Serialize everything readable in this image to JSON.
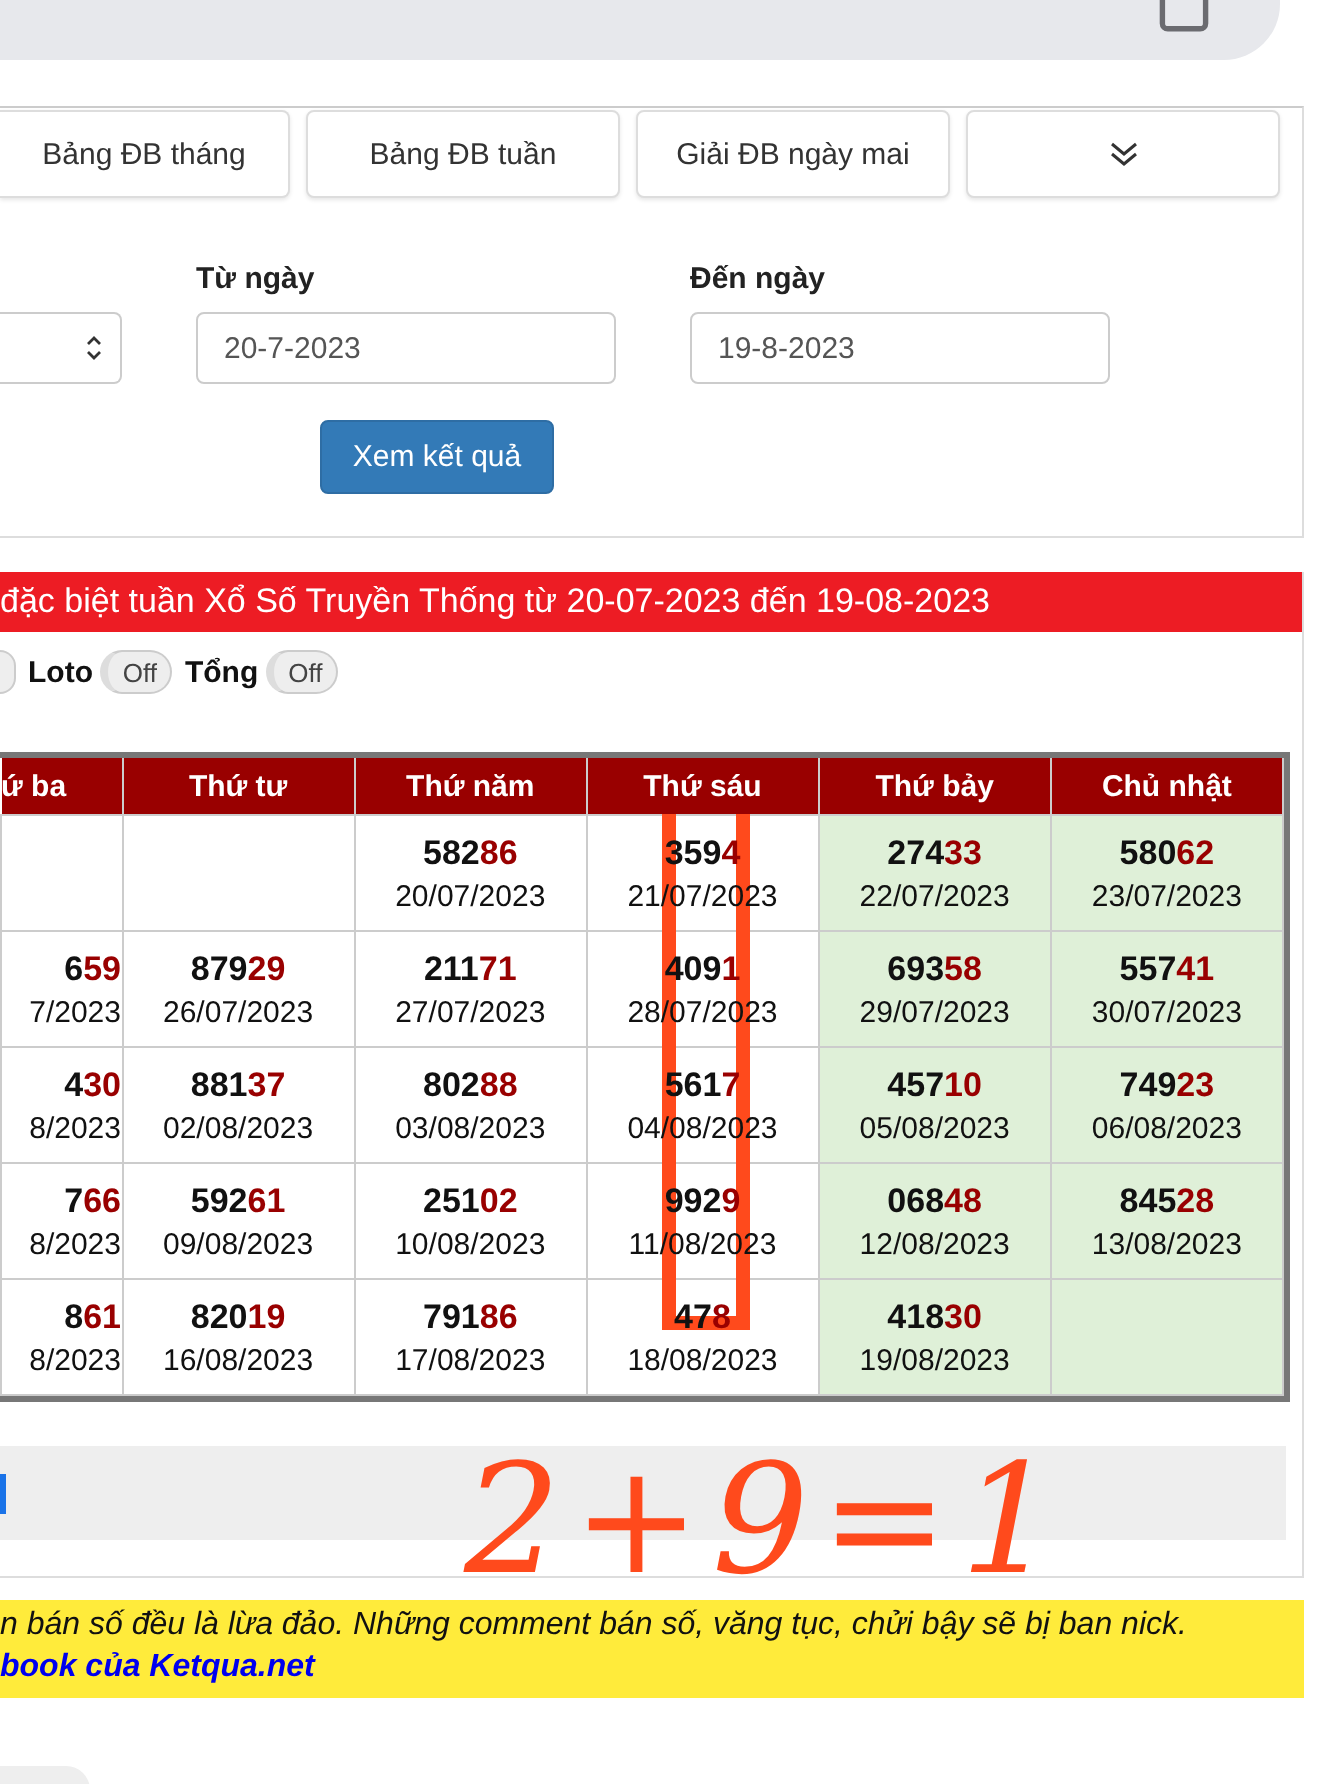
{
  "nav_buttons": [
    {
      "kind": "text",
      "label": "Bảng ĐB tháng"
    },
    {
      "kind": "text",
      "label": "Bảng ĐB tuần"
    },
    {
      "kind": "text",
      "label": "Giải ĐB ngày mai"
    },
    {
      "kind": "menu"
    }
  ],
  "filter": {
    "type_select": {
      "kind": "dropdown"
    },
    "from_label": "Từ ngày",
    "from_value": "20-7-2023",
    "to_label": "Đến ngày",
    "to_value": "19-8-2023",
    "button": "Xem kết quả"
  },
  "result_title": "đặc biệt tuần Xổ Số Truyền Thống từ 20-07-2023 đến 19-08-2023",
  "cut_toggle": {
    "on": false
  },
  "toggles": [
    {
      "label": "Loto",
      "state_text": "Off",
      "on": false
    },
    {
      "label": "Tổng",
      "state_text": "Off",
      "on": false
    }
  ],
  "table": {
    "columns": [
      {
        "label": "ứ ba",
        "weekend": false
      },
      {
        "label": "Thứ tư",
        "weekend": false
      },
      {
        "label": "Thứ năm",
        "weekend": false
      },
      {
        "label": "Thứ sáu",
        "weekend": false
      },
      {
        "label": "Thứ bảy",
        "weekend": true
      },
      {
        "label": "Chủ nhật",
        "weekend": true
      }
    ],
    "rows": [
      [
        {
          "kind": "empty"
        },
        {
          "kind": "empty"
        },
        {
          "kind": "result",
          "head": "582",
          "tail": "86",
          "date": "20/07/2023"
        },
        {
          "kind": "result",
          "head": "359",
          "tail": "4",
          "date": "21/07/2023"
        },
        {
          "kind": "result",
          "head": "274",
          "tail": "33",
          "date": "22/07/2023"
        },
        {
          "kind": "result",
          "head": "580",
          "tail": "62",
          "date": "23/07/2023"
        }
      ],
      [
        {
          "kind": "result",
          "head": "6",
          "tail": "59",
          "date": "7/2023"
        },
        {
          "kind": "result",
          "head": "879",
          "tail": "29",
          "date": "26/07/2023"
        },
        {
          "kind": "result",
          "head": "211",
          "tail": "71",
          "date": "27/07/2023"
        },
        {
          "kind": "result",
          "head": "409",
          "tail": "1",
          "date": "28/07/2023"
        },
        {
          "kind": "result",
          "head": "693",
          "tail": "58",
          "date": "29/07/2023"
        },
        {
          "kind": "result",
          "head": "557",
          "tail": "41",
          "date": "30/07/2023"
        }
      ],
      [
        {
          "kind": "result",
          "head": "4",
          "tail": "30",
          "date": "8/2023"
        },
        {
          "kind": "result",
          "head": "881",
          "tail": "37",
          "date": "02/08/2023"
        },
        {
          "kind": "result",
          "head": "802",
          "tail": "88",
          "date": "03/08/2023"
        },
        {
          "kind": "result",
          "head": "561",
          "tail": "7",
          "date": "04/08/2023"
        },
        {
          "kind": "result",
          "head": "457",
          "tail": "10",
          "date": "05/08/2023"
        },
        {
          "kind": "result",
          "head": "749",
          "tail": "23",
          "date": "06/08/2023"
        }
      ],
      [
        {
          "kind": "result",
          "head": "7",
          "tail": "66",
          "date": "8/2023"
        },
        {
          "kind": "result",
          "head": "592",
          "tail": "61",
          "date": "09/08/2023"
        },
        {
          "kind": "result",
          "head": "251",
          "tail": "02",
          "date": "10/08/2023"
        },
        {
          "kind": "result",
          "head": "992",
          "tail": "9",
          "date": "11/08/2023"
        },
        {
          "kind": "result",
          "head": "068",
          "tail": "48",
          "date": "12/08/2023"
        },
        {
          "kind": "result",
          "head": "845",
          "tail": "28",
          "date": "13/08/2023"
        }
      ],
      [
        {
          "kind": "result",
          "head": "8",
          "tail": "61",
          "date": "8/2023"
        },
        {
          "kind": "result",
          "head": "820",
          "tail": "19",
          "date": "16/08/2023"
        },
        {
          "kind": "result",
          "head": "791",
          "tail": "86",
          "date": "17/08/2023"
        },
        {
          "kind": "result",
          "head": "47",
          "tail": "8",
          "date": "18/08/2023"
        },
        {
          "kind": "result",
          "head": "418",
          "tail": "30",
          "date": "19/08/2023"
        },
        {
          "kind": "empty"
        }
      ]
    ]
  },
  "notice": {
    "text": "n bán số đều là lừa đảo. Những comment bán số, văng tục, chửi bậy sẽ bị ban nick.",
    "link": "book của Ketqua.net"
  },
  "annotation": {
    "handwriting": "2+9=1"
  }
}
